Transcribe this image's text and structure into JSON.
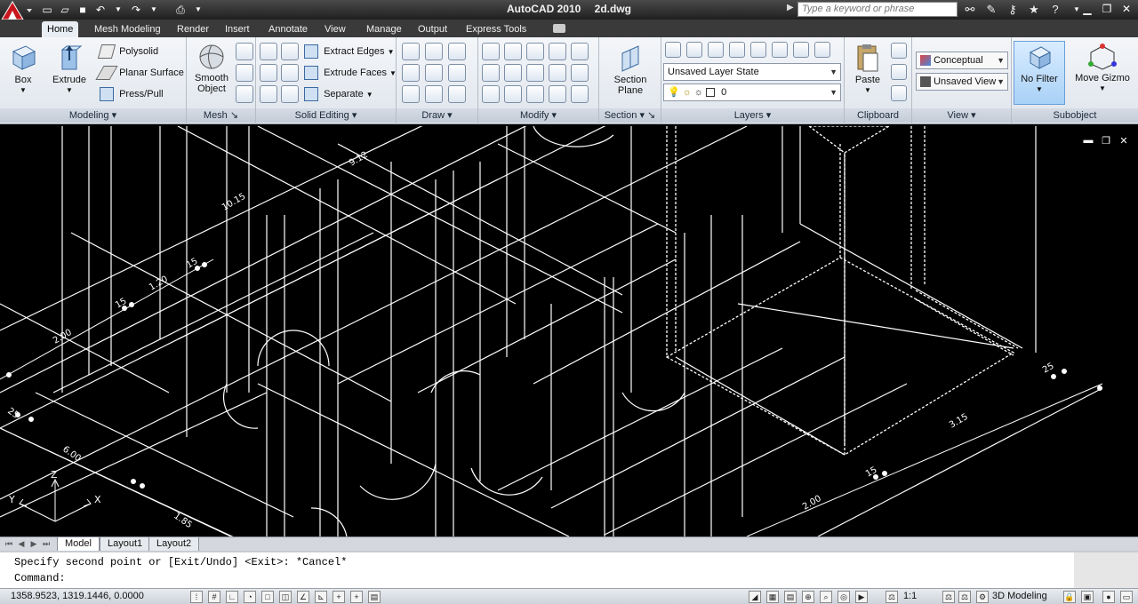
{
  "title_bar": {
    "app_name": "AutoCAD 2010",
    "file_name": "2d.dwg",
    "search_placeholder": "Type a keyword or phrase"
  },
  "tabs": [
    "Home",
    "Mesh Modeling",
    "Render",
    "Insert",
    "Annotate",
    "View",
    "Manage",
    "Output",
    "Express Tools"
  ],
  "ribbon": {
    "modeling": {
      "title": "Modeling",
      "box": "Box",
      "extrude": "Extrude",
      "polysolid": "Polysolid",
      "planar_surface": "Planar Surface",
      "press_pull": "Press/Pull"
    },
    "mesh": {
      "title": "Mesh",
      "smooth_object_1": "Smooth",
      "smooth_object_2": "Object"
    },
    "solid_editing": {
      "title": "Solid Editing",
      "extract_edges": "Extract Edges",
      "extrude_faces": "Extrude Faces",
      "separate": "Separate"
    },
    "draw": {
      "title": "Draw"
    },
    "modify": {
      "title": "Modify"
    },
    "section": {
      "title": "Section",
      "section_plane_1": "Section",
      "section_plane_2": "Plane"
    },
    "layers": {
      "title": "Layers",
      "layer_state": "Unsaved Layer State",
      "current_layer": "0"
    },
    "clipboard": {
      "title": "Clipboard",
      "paste": "Paste"
    },
    "view": {
      "title": "View",
      "visual_style": "Conceptual",
      "named_view": "Unsaved View"
    },
    "subobject": {
      "title": "Subobject",
      "no_filter": "No Filter",
      "move_gizmo": "Move Gizmo"
    }
  },
  "drawing": {
    "dimension_labels": [
      "2.00",
      "15",
      "1.20",
      "15",
      "10.15",
      "9.12",
      "25",
      "3.15",
      "2.00",
      "15",
      "6.00",
      "1.85",
      "25"
    ],
    "ucs": {
      "z": "Z",
      "x": "X",
      "y": "Y"
    }
  },
  "layout_tabs": [
    "Model",
    "Layout1",
    "Layout2"
  ],
  "command_line": {
    "history": "Specify second point or [Exit/Undo] <Exit>: *Cancel*",
    "prompt": "Command:"
  },
  "status_bar": {
    "coordinates": "1358.9523, 1319.1446, 0.0000",
    "annotation_scale": "1:1",
    "workspace": "3D Modeling"
  }
}
